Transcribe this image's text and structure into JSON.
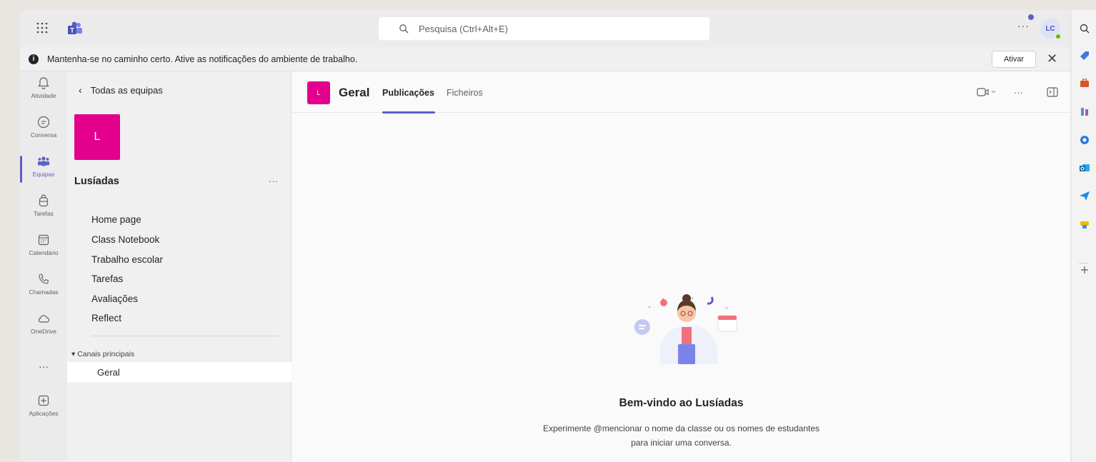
{
  "topbar": {
    "search_placeholder": "Pesquisa (Ctrl+Alt+E)",
    "more": "···",
    "avatar_initials": "LC"
  },
  "banner": {
    "text": "Mantenha-se no caminho certo. Ative as notificações do ambiente de trabalho.",
    "activate_label": "Ativar",
    "close": "✕"
  },
  "rail": {
    "items": [
      {
        "label": "Atividade",
        "icon": "bell-icon"
      },
      {
        "label": "Conversa",
        "icon": "chat-icon"
      },
      {
        "label": "Equipas",
        "icon": "teams-icon"
      },
      {
        "label": "Tarefas",
        "icon": "backpack-icon"
      },
      {
        "label": "Calendário",
        "icon": "calendar-icon"
      },
      {
        "label": "Chamadas",
        "icon": "phone-icon"
      },
      {
        "label": "OneDrive",
        "icon": "cloud-icon"
      },
      {
        "label": "",
        "icon": "more-icon"
      },
      {
        "label": "Aplicações",
        "icon": "add-apps-icon"
      }
    ],
    "more": "···"
  },
  "team": {
    "back_label": "Todas as equipas",
    "tile_letter": "L",
    "name": "Lusíadas",
    "more": "···",
    "nav": [
      "Home page",
      "Class Notebook",
      "Trabalho escolar",
      "Tarefas",
      "Avaliações",
      "Reflect"
    ],
    "channels_header": "Canais principais",
    "channel": "Geral"
  },
  "main": {
    "channel_tile": "L",
    "channel_name": "Geral",
    "tabs": [
      "Publicações",
      "Ficheiros"
    ],
    "welcome_title": "Bem-vindo ao Lusíadas",
    "welcome_line1": "Experimente @mencionar o nome da classe ou os nomes de estudantes",
    "welcome_line2": "para iniciar uma conversa.",
    "header_more": "···"
  },
  "colors": {
    "accent": "#5b5fc7",
    "team_tile": "#e3008c"
  }
}
